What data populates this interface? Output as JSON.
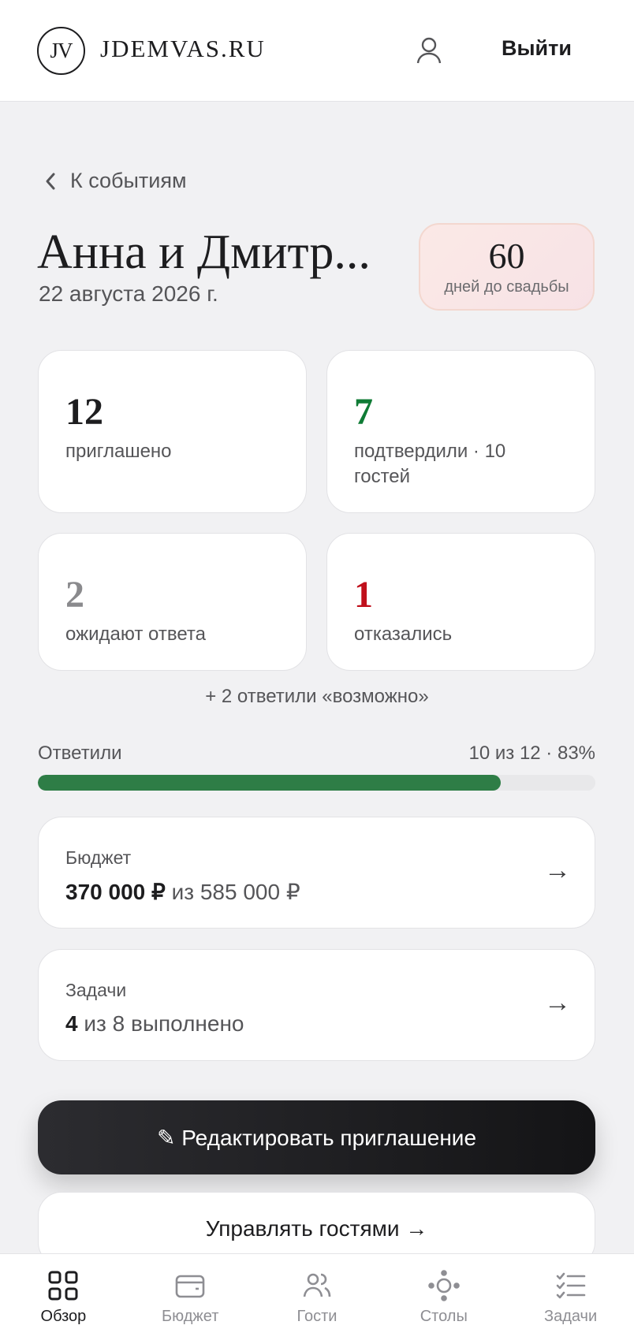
{
  "header": {
    "logo_mark": "JV",
    "logo_text": "JDEMVAS.RU",
    "logout_label": "Выйти"
  },
  "back_link": "К событиям",
  "event": {
    "title": "Анна и Дмитр...",
    "date": "22 августа 2026 г.",
    "countdown_number": "60",
    "countdown_label": "дней до свадьбы"
  },
  "stats": [
    {
      "value": "12",
      "label": "приглашено",
      "color": "#1d1d1f"
    },
    {
      "value": "7",
      "label": "подтвердили · 10 гостей",
      "color": "#0f7b35"
    },
    {
      "value": "2",
      "label": "ожидают ответа",
      "color": "#8a8a8d"
    },
    {
      "value": "1",
      "label": "отказались",
      "color": "#c0101c"
    }
  ],
  "maybe_note": "+ 2 ответили «возможно»",
  "responses": {
    "label": "Ответили",
    "value_text": "10 из 12 · 83%",
    "fraction": 0.83
  },
  "budget": {
    "title": "Бюджет",
    "spent": "370 000 ₽",
    "total_text": "из 585 000 ₽",
    "arrow": "→"
  },
  "tasks": {
    "title": "Задачи",
    "done": "4",
    "total_text": "из 8 выполнено",
    "arrow": "→"
  },
  "buttons": {
    "edit_invite": "✎ Редактировать приглашение",
    "manage_guests": "Управлять гостями →"
  },
  "nav": [
    {
      "label": "Обзор",
      "icon": "grid-icon",
      "active": true
    },
    {
      "label": "Бюджет",
      "icon": "wallet-icon",
      "active": false
    },
    {
      "label": "Гости",
      "icon": "guests-icon",
      "active": false
    },
    {
      "label": "Столы",
      "icon": "tables-icon",
      "active": false
    },
    {
      "label": "Задачи",
      "icon": "checklist-icon",
      "active": false
    }
  ]
}
